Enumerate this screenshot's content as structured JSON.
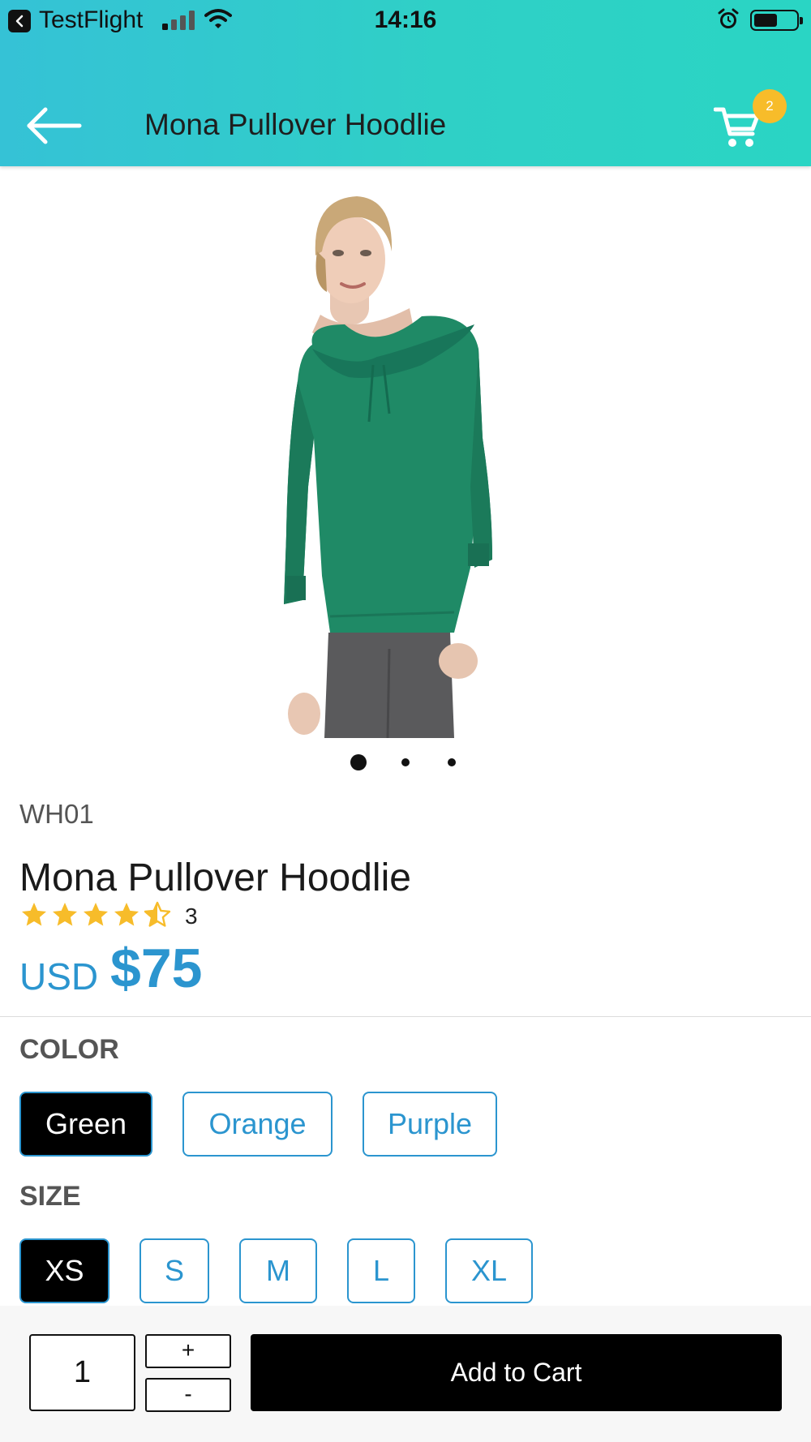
{
  "status_bar": {
    "app_name": "TestFlight",
    "time": "14:16"
  },
  "nav": {
    "title": "Mona Pullover Hoodlie",
    "cart_count": "2",
    "back_icon": "arrow-left-icon",
    "cart_icon": "shopping-cart-icon"
  },
  "product": {
    "image_description": "green pullover hoodie",
    "image_count": 3,
    "active_image_index": 0,
    "sku": "WH01",
    "name": "Mona Pullover Hoodlie",
    "rating": 4.5,
    "rating_max": 5,
    "review_count": "3",
    "currency": "USD",
    "price": "$75"
  },
  "color": {
    "label": "COLOR",
    "options": [
      "Green",
      "Orange",
      "Purple"
    ],
    "selected": "Green"
  },
  "size": {
    "label": "SIZE",
    "options": [
      "XS",
      "S",
      "M",
      "L",
      "XL"
    ],
    "selected": "XS"
  },
  "cart_bar": {
    "quantity": "1",
    "increment_label": "+",
    "decrement_label": "-",
    "add_to_cart_label": "Add to Cart"
  },
  "colors": {
    "header_gradient_start": "#35c2d6",
    "header_gradient_end": "#2ad5c4",
    "accent": "#2b95cf",
    "badge": "#f7bc2a",
    "star": "#f7bc2a",
    "hoodie": "#1f8a66"
  }
}
